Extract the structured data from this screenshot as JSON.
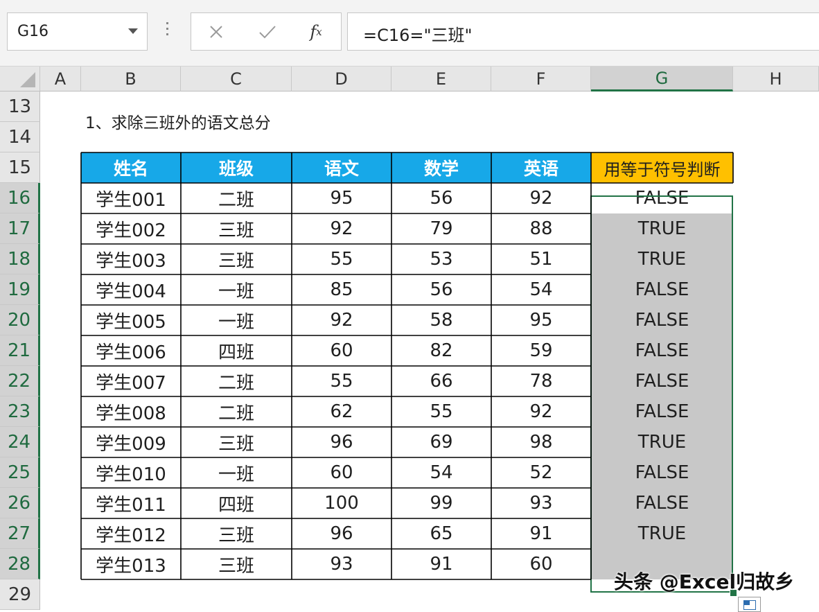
{
  "formula_bar": {
    "name_box": "G16",
    "formula": "=C16=\"三班\""
  },
  "columns": [
    "A",
    "B",
    "C",
    "D",
    "E",
    "F",
    "G",
    "H"
  ],
  "rows": [
    "13",
    "14",
    "15",
    "16",
    "17",
    "18",
    "19",
    "20",
    "21",
    "22",
    "23",
    "24",
    "25",
    "26",
    "27",
    "28",
    "29"
  ],
  "title_cell": "1、求除三班外的语文总分",
  "table": {
    "headers": [
      "姓名",
      "班级",
      "语文",
      "数学",
      "英语",
      "用等于符号判断"
    ],
    "rows": [
      [
        "学生001",
        "二班",
        "95",
        "56",
        "92",
        "FALSE"
      ],
      [
        "学生002",
        "三班",
        "92",
        "79",
        "88",
        "TRUE"
      ],
      [
        "学生003",
        "三班",
        "55",
        "53",
        "51",
        "TRUE"
      ],
      [
        "学生004",
        "一班",
        "85",
        "56",
        "54",
        "FALSE"
      ],
      [
        "学生005",
        "一班",
        "92",
        "58",
        "95",
        "FALSE"
      ],
      [
        "学生006",
        "四班",
        "60",
        "82",
        "59",
        "FALSE"
      ],
      [
        "学生007",
        "二班",
        "55",
        "66",
        "78",
        "FALSE"
      ],
      [
        "学生008",
        "二班",
        "62",
        "55",
        "92",
        "FALSE"
      ],
      [
        "学生009",
        "三班",
        "96",
        "69",
        "98",
        "TRUE"
      ],
      [
        "学生010",
        "一班",
        "60",
        "54",
        "52",
        "FALSE"
      ],
      [
        "学生011",
        "四班",
        "100",
        "99",
        "93",
        "FALSE"
      ],
      [
        "学生012",
        "三班",
        "96",
        "65",
        "91",
        "TRUE"
      ],
      [
        "学生013",
        "三班",
        "93",
        "91",
        "60",
        ""
      ]
    ]
  },
  "selected_cell": "G16",
  "watermark": "头条 @Excel归故乡",
  "colors": {
    "header_bg": "#17a8e8",
    "judge_header_bg": "#ffc000",
    "selection": "#217346"
  }
}
